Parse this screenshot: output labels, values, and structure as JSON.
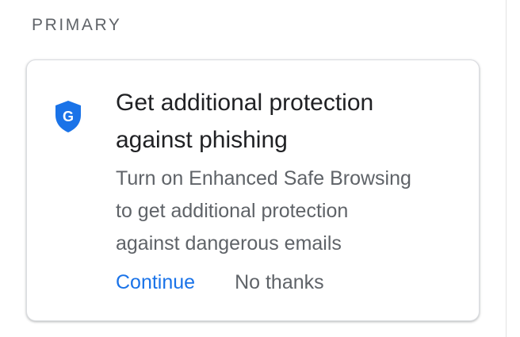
{
  "section": {
    "label": "PRIMARY"
  },
  "promo": {
    "icon": "google-shield-icon",
    "icon_letter": "G",
    "title_line1": "Get additional protection",
    "title_line2": "against phishing",
    "desc_line1": "Turn on Enhanced Safe Browsing",
    "desc_line2": "to get additional protection",
    "desc_line3": "against dangerous emails",
    "continue_label": "Continue",
    "dismiss_label": "No thanks"
  },
  "colors": {
    "accent": "#1a73e8",
    "text_primary": "#202124",
    "text_secondary": "#5f6368",
    "border": "#dadce0"
  }
}
